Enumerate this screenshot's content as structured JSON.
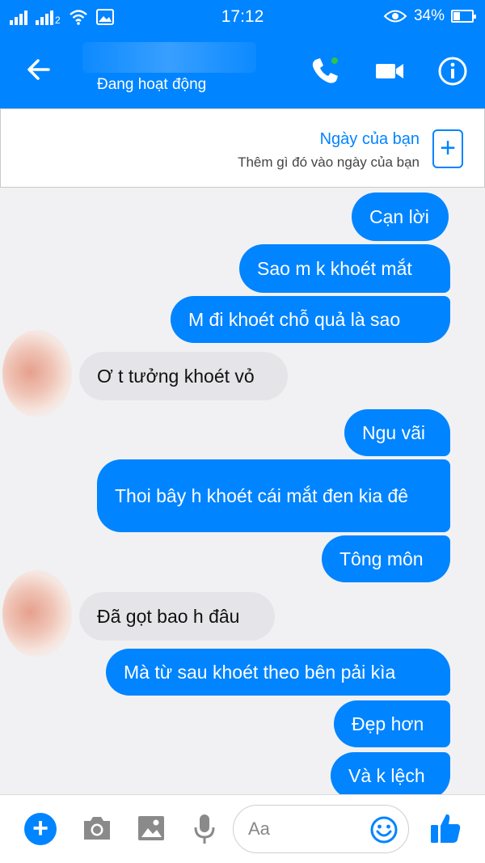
{
  "status_bar": {
    "sim2_label": "2",
    "time": "17:12",
    "battery_percent": "34%"
  },
  "header": {
    "presence": "Đang hoạt động"
  },
  "my_day": {
    "title": "Ngày của bạn",
    "subtitle": "Thêm gì đó vào ngày của bạn",
    "add_symbol": "+"
  },
  "messages": [
    {
      "direction": "out",
      "text": "Cạn lời"
    },
    {
      "direction": "out",
      "text": "Sao m k khoét mắt"
    },
    {
      "direction": "out",
      "text": "M đi khoét chỗ quả là sao"
    },
    {
      "direction": "in",
      "text": "Ơ t tưởng khoét vỏ"
    },
    {
      "direction": "out",
      "text": "Ngu vãi"
    },
    {
      "direction": "out",
      "text": "Thoi bây h khoét cái mắt đen kia đê"
    },
    {
      "direction": "out",
      "text": "Tông môn"
    },
    {
      "direction": "in",
      "text": "Đã gọt bao h đâu"
    },
    {
      "direction": "out",
      "text": "Mà từ sau khoét theo bên pải kìa"
    },
    {
      "direction": "out",
      "text": "Đẹp hơn"
    },
    {
      "direction": "out",
      "text": "Và k lệch"
    }
  ],
  "composer": {
    "placeholder": "Aa"
  },
  "colors": {
    "accent": "#0084ff",
    "incoming_bubble": "#e5e5e9",
    "background": "#f1f1f3"
  },
  "icons": [
    "back-arrow-icon",
    "phone-icon",
    "video-camera-icon",
    "info-icon",
    "plus-icon",
    "camera-icon",
    "image-icon",
    "microphone-icon",
    "emoji-icon",
    "thumbs-up-icon"
  ]
}
